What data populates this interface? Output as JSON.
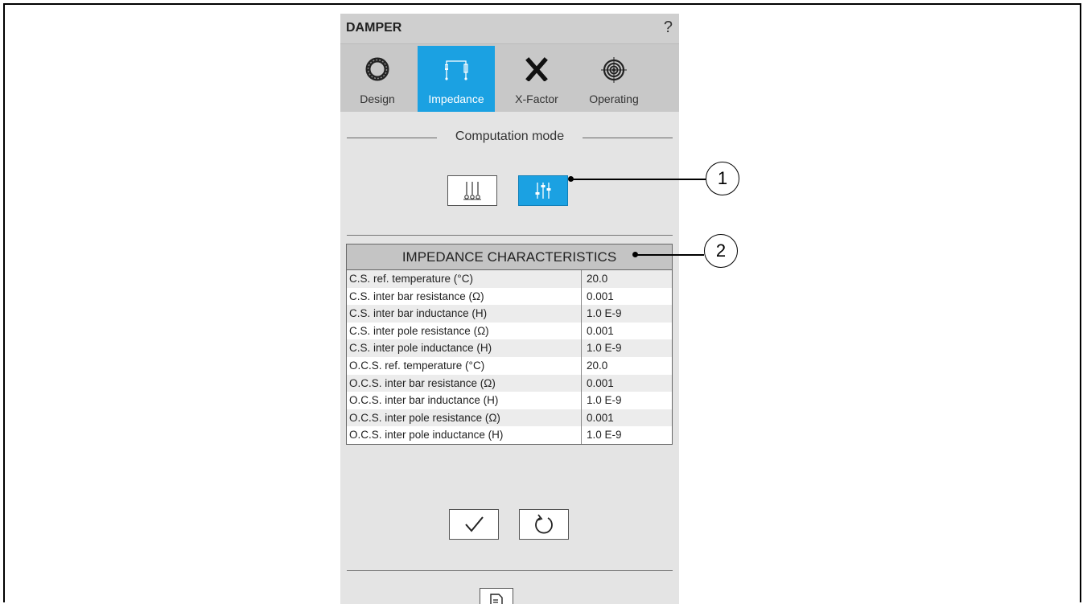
{
  "window": {
    "title": "DAMPER",
    "help_label": "?"
  },
  "tabs": [
    {
      "label": "Design",
      "icon": "ring-icon",
      "active": false
    },
    {
      "label": "Impedance",
      "icon": "impedance-icon",
      "active": true
    },
    {
      "label": "X-Factor",
      "icon": "x-factor-icon",
      "active": false
    },
    {
      "label": "Operating",
      "icon": "target-icon",
      "active": false
    }
  ],
  "computation_mode": {
    "legend": "Computation mode",
    "options": [
      {
        "icon": "fixed-sliders-icon",
        "selected": false
      },
      {
        "icon": "adjustable-sliders-icon",
        "selected": true
      }
    ]
  },
  "impedance": {
    "header": "IMPEDANCE CHARACTERISTICS",
    "rows": [
      {
        "label": "C.S. ref. temperature (°C)",
        "value": "20.0"
      },
      {
        "label": "C.S. inter bar resistance (Ω)",
        "value": "0.001"
      },
      {
        "label": "C.S. inter bar inductance (H)",
        "value": "1.0 E-9"
      },
      {
        "label": "C.S. inter pole resistance (Ω)",
        "value": "0.001"
      },
      {
        "label": "C.S. inter pole inductance (H)",
        "value": "1.0 E-9"
      },
      {
        "label": "O.C.S. ref. temperature (°C)",
        "value": "20.0"
      },
      {
        "label": "O.C.S. inter bar resistance (Ω)",
        "value": "0.001"
      },
      {
        "label": "O.C.S. inter bar inductance (H)",
        "value": "1.0 E-9"
      },
      {
        "label": "O.C.S. inter pole resistance (Ω)",
        "value": "0.001"
      },
      {
        "label": "O.C.S. inter pole inductance (H)",
        "value": "1.0 E-9"
      }
    ]
  },
  "actions": {
    "confirm_icon": "checkmark-icon",
    "reset_icon": "reset-icon",
    "export_icon": "export-icon"
  },
  "callouts": [
    "1",
    "2"
  ],
  "colors": {
    "accent": "#1ba1e2",
    "panel_bg": "#e4e4e4",
    "tabbar_bg": "#c8c8c8"
  }
}
